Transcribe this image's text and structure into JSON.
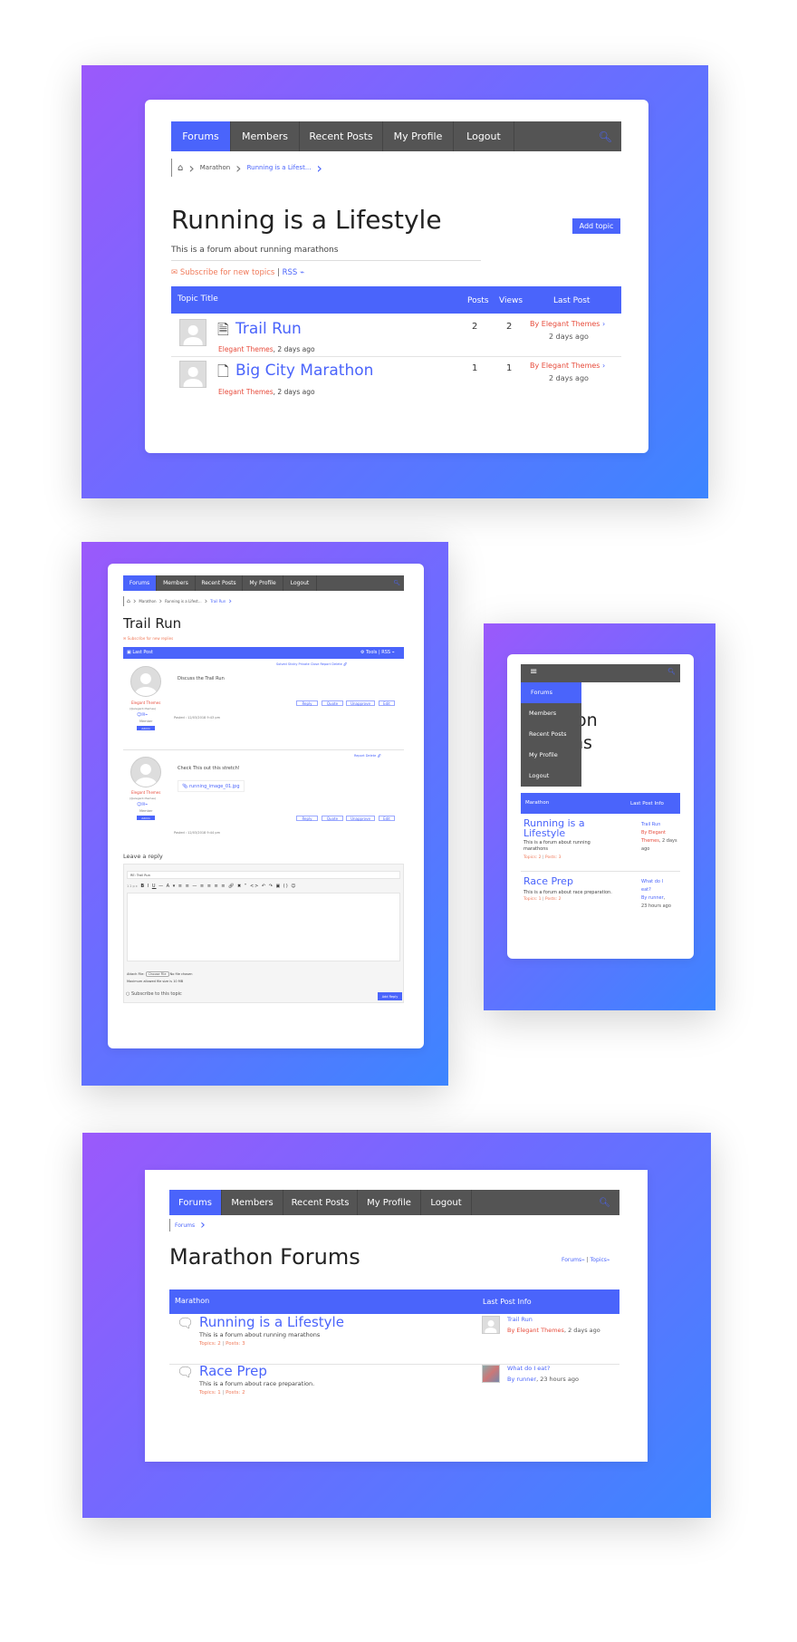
{
  "nav": {
    "items": [
      "Forums",
      "Members",
      "Recent Posts",
      "My Profile",
      "Logout"
    ],
    "active": "Forums"
  },
  "screen1": {
    "breadcrumb": [
      "Marathon",
      "Running is a Lifest..."
    ],
    "title": "Running is a Lifestyle",
    "add_topic": "Add topic",
    "description": "This is a forum about running marathons",
    "subscribe": "Subscribe for new topics",
    "rss_sep": "|",
    "rss": "RSS",
    "headers": {
      "title": "Topic Title",
      "posts": "Posts",
      "views": "Views",
      "last_post": "Last Post"
    },
    "topics": [
      {
        "title": "Trail Run",
        "author": "Elegant Themes",
        "time": ", 2 days  ago",
        "posts": "2",
        "views": "2",
        "last_by": "By Elegant Themes",
        "last_time": "2 days  ago"
      },
      {
        "title": "Big City Marathon",
        "author": "Elegant Themes",
        "time": ", 2 days  ago",
        "posts": "1",
        "views": "1",
        "last_by": "By Elegant Themes",
        "last_time": "2 days  ago"
      }
    ]
  },
  "screen2": {
    "breadcrumb": [
      "Marathon",
      "Running is a Lifest...",
      "Trail Run"
    ],
    "title": "Trail Run",
    "subscribe": "Subscribe for new replies",
    "bar_left": "Last Post",
    "tools": "Tools",
    "rss": "RSS",
    "post_actions_1": [
      "Solved",
      "Sticky",
      "Private",
      "Close",
      "Report",
      "Delete"
    ],
    "post_actions_2": [
      "Report",
      "Delete"
    ],
    "reply_buttons": [
      "Reply",
      "Quote",
      "Unapprove",
      "Edit"
    ],
    "posts": [
      {
        "author": "Elegant Themes",
        "handle": "(@elegant-themes)",
        "role": "Member",
        "badge": "Admin",
        "content": "Discuss the Trail Run",
        "posted": "Posted : 12/03/2018 9:43 pm"
      },
      {
        "author": "Elegant Themes",
        "handle": "(@elegant-themes)",
        "role": "Member",
        "badge": "Admin",
        "content": "Check This out this stretch!",
        "attachment": "running_image_01.jpg",
        "posted": "Posted : 12/03/2018 9:44 pm"
      }
    ],
    "leave_reply": "Leave a reply",
    "reply_title_value": "RE: Trail Run",
    "font_size": "12px",
    "attach_label": "Attach File:",
    "choose_file": "Choose File",
    "no_file": "No file chosen",
    "max_size": "Maximum allowed file size is 10 MB",
    "subscribe_topic": "Subscribe to this topic",
    "add_reply": "Add Reply"
  },
  "screen3": {
    "menu": [
      "Forums",
      "Members",
      "Recent Posts",
      "My Profile",
      "Logout"
    ],
    "title_fragment_1": "non",
    "title_fragment_2": "ns",
    "headers": {
      "forum": "Marathon",
      "last": "Last Post Info"
    },
    "forums": [
      {
        "title": "Running is a Lifestyle",
        "desc": "This is a forum about running marathons",
        "topics": "Topics: 2",
        "posts": "Posts: 3",
        "last_title": "Trail Run",
        "last_by": "By Elegant Themes",
        "last_time": ", 2 days  ago"
      },
      {
        "title": "Race Prep",
        "desc": "This is a forum about race preparation.",
        "topics": "Topics: 1",
        "posts": "Posts: 2",
        "last_title": "What do I eat?",
        "last_by": "By runner",
        "last_time": ", 23 hours  ago"
      }
    ]
  },
  "screen4": {
    "breadcrumb": [
      "Forums"
    ],
    "title": "Marathon Forums",
    "feed_forums": "Forums",
    "feed_topics": "Topics",
    "headers": {
      "forum": "Marathon",
      "last": "Last Post Info"
    },
    "forums": [
      {
        "title": "Running is a Lifestyle",
        "desc": "This is a forum about running marathons",
        "topics": "Topics: 2",
        "posts": "Posts: 3",
        "last_title": "Trail Run",
        "last_by": "By Elegant Themes",
        "last_time": ", 2 days  ago"
      },
      {
        "title": "Race Prep",
        "desc": "This is a forum about race preparation.",
        "topics": "Topics: 1",
        "posts": "Posts: 2",
        "last_title": "What do I eat?",
        "last_by": "By runner",
        "last_time": ", 23 hours  ago"
      }
    ]
  },
  "colors": {
    "accent": "#4a64fb",
    "nav_bg": "#545454",
    "author_red": "#e74c3c",
    "gradient_start": "#9b59fb",
    "gradient_end": "#3d85ff"
  }
}
